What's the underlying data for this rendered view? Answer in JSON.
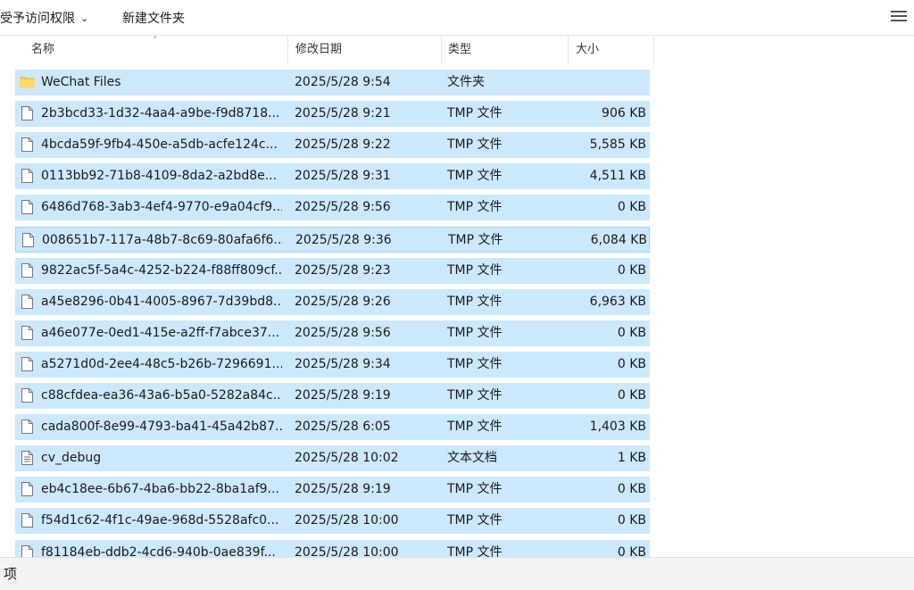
{
  "toolbar": {
    "access_label": "受予访问权限",
    "new_folder_label": "新建文件夹",
    "view_icon": "hamburger-menu-icon"
  },
  "columns": {
    "name": "名称",
    "date": "修改日期",
    "type": "类型",
    "size": "大小"
  },
  "colors": {
    "selection": "#cce8ff",
    "selection_border": "#99d1ff",
    "folder": "#f8c745"
  },
  "files": [
    {
      "name": "WeChat Files",
      "date": "2025/5/28 9:54",
      "type": "文件夹",
      "size": "",
      "icon": "folder-icon"
    },
    {
      "name": "2b3bcd33-1d32-4aa4-a9be-f9d8718...",
      "date": "2025/5/28 9:21",
      "type": "TMP 文件",
      "size": "906 KB",
      "icon": "file-icon"
    },
    {
      "name": "4bcda59f-9fb4-450e-a5db-acfe124c...",
      "date": "2025/5/28 9:22",
      "type": "TMP 文件",
      "size": "5,585 KB",
      "icon": "file-icon"
    },
    {
      "name": "0113bb92-71b8-4109-8da2-a2bd8e...",
      "date": "2025/5/28 9:31",
      "type": "TMP 文件",
      "size": "4,511 KB",
      "icon": "file-icon"
    },
    {
      "name": "6486d768-3ab3-4ef4-9770-e9a04cf9...",
      "date": "2025/5/28 9:56",
      "type": "TMP 文件",
      "size": "0 KB",
      "icon": "file-icon"
    },
    {
      "name": "008651b7-117a-48b7-8c69-80afa6f6...",
      "date": "2025/5/28 9:36",
      "type": "TMP 文件",
      "size": "6,084 KB",
      "icon": "file-icon"
    },
    {
      "name": "9822ac5f-5a4c-4252-b224-f88ff809cf...",
      "date": "2025/5/28 9:23",
      "type": "TMP 文件",
      "size": "0 KB",
      "icon": "file-icon"
    },
    {
      "name": "a45e8296-0b41-4005-8967-7d39bd8...",
      "date": "2025/5/28 9:26",
      "type": "TMP 文件",
      "size": "6,963 KB",
      "icon": "file-icon"
    },
    {
      "name": "a46e077e-0ed1-415e-a2ff-f7abce37...",
      "date": "2025/5/28 9:56",
      "type": "TMP 文件",
      "size": "0 KB",
      "icon": "file-icon"
    },
    {
      "name": "a5271d0d-2ee4-48c5-b26b-7296691...",
      "date": "2025/5/28 9:34",
      "type": "TMP 文件",
      "size": "0 KB",
      "icon": "file-icon"
    },
    {
      "name": "c88cfdea-ea36-43a6-b5a0-5282a84c...",
      "date": "2025/5/28 9:19",
      "type": "TMP 文件",
      "size": "0 KB",
      "icon": "file-icon"
    },
    {
      "name": "cada800f-8e99-4793-ba41-45a42b87...",
      "date": "2025/5/28 6:05",
      "type": "TMP 文件",
      "size": "1,403 KB",
      "icon": "file-icon"
    },
    {
      "name": "cv_debug",
      "date": "2025/5/28 10:02",
      "type": "文本文档",
      "size": "1 KB",
      "icon": "text-document-icon"
    },
    {
      "name": "eb4c18ee-6b67-4ba6-bb22-8ba1af9...",
      "date": "2025/5/28 9:19",
      "type": "TMP 文件",
      "size": "0 KB",
      "icon": "file-icon"
    },
    {
      "name": "f54d1c62-4f1c-49ae-968d-5528afc0...",
      "date": "2025/5/28 10:00",
      "type": "TMP 文件",
      "size": "0 KB",
      "icon": "file-icon"
    },
    {
      "name": "f81184eb-ddb2-4cd6-940b-0ae839f...",
      "date": "2025/5/28 10:00",
      "type": "TMP 文件",
      "size": "0 KB",
      "icon": "file-icon"
    }
  ],
  "status": {
    "text": "项"
  }
}
